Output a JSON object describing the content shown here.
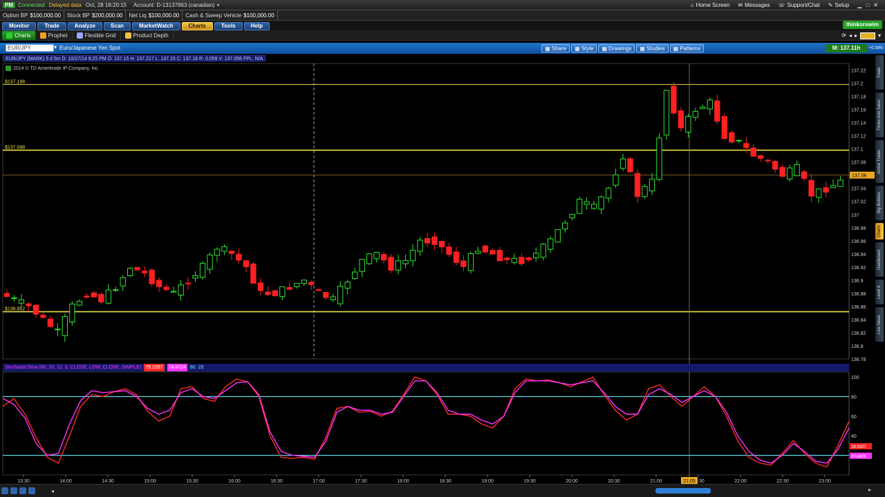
{
  "account_bar": {
    "pm": "PM",
    "connected": "Connected",
    "delayed": "Delayed data",
    "datetime": "Oct, 28  18:20:15",
    "account": "Account: D-13137963 (canadian)",
    "links": [
      {
        "label": "Home Screen",
        "icon": "home-icon"
      },
      {
        "label": "Messages",
        "icon": "envelope-icon"
      },
      {
        "label": "Support/Chat",
        "icon": "headset-icon"
      },
      {
        "label": "Setup",
        "icon": "wrench-icon"
      }
    ]
  },
  "balances": [
    {
      "label": "Option BP",
      "value": "$100,000.00"
    },
    {
      "label": "Stock BP",
      "value": "$200,000.00"
    },
    {
      "label": "Net Liq",
      "value": "$100,000.00"
    },
    {
      "label": "Cash & Sweep Vehicle",
      "value": "$100,000.00"
    }
  ],
  "main_tabs": [
    "Monitor",
    "Trade",
    "Analyze",
    "Scan",
    "MarketWatch",
    "Charts",
    "Tools",
    "Help"
  ],
  "main_tab_active": "Charts",
  "sub_tabs": [
    "Charts",
    "Prophet",
    "Flexible Grid",
    "Product Depth"
  ],
  "sub_tab_active": "Charts",
  "thinkorswim_label": "thinkorswim",
  "chart_toolbar": {
    "symbol": "EUR/JPY",
    "description": "Euro/Japanese Yen Spot",
    "buttons": [
      "Share",
      "Style",
      "Drawings",
      "Studies",
      "Patterns"
    ],
    "price_badge": "M: 137.11h",
    "change_badge": "+0.38%"
  },
  "ohlc_header": "EUR/JPY (MARK) 5 d 5m  D: 10/27/14 9:25 PM  O: 137.15  H: 137.217  L: 137.15  C: 137.16  R: 0.059  V: 137.056  FPL: N/A",
  "copyright": "2014 © TD Ameritrade IP Company, Inc.",
  "price_lines": [
    {
      "label": "$137.198",
      "value": 137.198,
      "color": "#f0e04a"
    },
    {
      "label": "$137.098",
      "value": 137.098,
      "color": "#f0e04a"
    },
    {
      "label": "$136.852",
      "value": 136.852,
      "color": "#f0e04a"
    }
  ],
  "last_price_tag": "137.06",
  "stoch_header": {
    "name": "StochasticSlow (80, 20, 12, 3, CLOSE, LOW, CLOSE, SIMPLE)",
    "k": "79.2267",
    "d": "74.8724",
    "ob": "80",
    "os": "20"
  },
  "stoch_tags": {
    "k": "28.9107",
    "d": "20.6506"
  },
  "x_tick_labels": [
    "13:30",
    "14:00",
    "14:30",
    "15:00",
    "15:30",
    "16:00",
    "16:30",
    "17:00",
    "17:30",
    "18:00",
    "18:30",
    "19:00",
    "19:30",
    "20:00",
    "20:30",
    "21:00",
    "21:30",
    "22:00",
    "22:30",
    "23:00"
  ],
  "crosshair_time": "21:05",
  "side_tabs": [
    "Trade",
    "Times And Sales",
    "Active Trader",
    "Big Buttons",
    "Charts",
    "Dashboard",
    "Level II",
    "Live News"
  ],
  "side_tab_active": "Charts",
  "chart_data": [
    {
      "type": "candlestick",
      "title": "EUR/JPY (MARK) 5 d 5m",
      "ylim": [
        136.78,
        137.23
      ],
      "yticks": [
        137.22,
        137.2,
        137.18,
        137.16,
        137.14,
        137.12,
        137.1,
        137.08,
        137.06,
        137.04,
        137.02,
        137,
        136.98,
        136.96,
        136.94,
        136.92,
        136.9,
        136.88,
        136.86,
        136.84,
        136.82,
        136.8,
        136.78
      ],
      "ytick_labels": [
        "137.22",
        "137.2",
        "137.18",
        "137.16",
        "137.14",
        "137.12",
        "137.1",
        "137.08",
        "137.06",
        "137.04",
        "137.02",
        "137",
        "136.98",
        "136.96",
        "136.94",
        "136.92",
        "136.9",
        "136.88",
        "136.86",
        "136.84",
        "136.82",
        "136.8",
        "136.78"
      ],
      "x_range": [
        "13:25",
        "23:15"
      ],
      "close_path": [
        136.87,
        136.86,
        136.84,
        136.82,
        136.86,
        136.88,
        136.87,
        136.89,
        136.92,
        136.91,
        136.89,
        136.88,
        136.9,
        136.92,
        136.95,
        136.94,
        136.92,
        136.88,
        136.88,
        136.89,
        136.9,
        136.88,
        136.87,
        136.9,
        136.93,
        136.94,
        136.92,
        136.93,
        136.96,
        136.96,
        136.94,
        136.92,
        136.95,
        136.94,
        136.93,
        136.93,
        136.94,
        136.96,
        136.99,
        137.02,
        137.01,
        137.04,
        137.09,
        137.03,
        137.05,
        137.19,
        137.13,
        137.16,
        137.17,
        137.12,
        137.11,
        137.09,
        137.08,
        137.06,
        137.07,
        137.03,
        137.04,
        137.05
      ]
    },
    {
      "type": "line",
      "title": "StochasticSlow (80, 20, 12, 3, CLOSE, LOW, CLOSE, SIMPLE)",
      "ylim": [
        0,
        105
      ],
      "yticks": [
        100,
        80,
        60,
        40
      ],
      "ytick_labels": [
        "100",
        "80",
        "60",
        "40"
      ],
      "levels": [
        80,
        20
      ],
      "series": [
        {
          "name": "k",
          "color": "#ff2a2a",
          "values": [
            70,
            78,
            62,
            38,
            18,
            12,
            40,
            70,
            82,
            80,
            85,
            88,
            82,
            65,
            55,
            60,
            88,
            90,
            78,
            75,
            90,
            98,
            95,
            80,
            40,
            18,
            17,
            18,
            16,
            38,
            68,
            70,
            64,
            65,
            60,
            65,
            82,
            100,
            96,
            82,
            62,
            62,
            60,
            52,
            48,
            60,
            88,
            98,
            96,
            97,
            94,
            90,
            95,
            100,
            82,
            66,
            56,
            62,
            88,
            92,
            80,
            70,
            80,
            90,
            80,
            60,
            35,
            18,
            12,
            10,
            22,
            35,
            22,
            12,
            8,
            30,
            55
          ]
        },
        {
          "name": "d",
          "color": "#ff33ff",
          "values": [
            78,
            72,
            58,
            32,
            20,
            22,
            52,
            76,
            86,
            84,
            85,
            86,
            80,
            68,
            62,
            66,
            84,
            88,
            80,
            78,
            86,
            94,
            95,
            82,
            44,
            24,
            20,
            19,
            18,
            34,
            64,
            70,
            66,
            66,
            62,
            64,
            80,
            96,
            96,
            84,
            66,
            62,
            62,
            56,
            52,
            60,
            84,
            96,
            96,
            96,
            94,
            92,
            94,
            96,
            84,
            70,
            62,
            62,
            82,
            88,
            82,
            74,
            80,
            86,
            80,
            64,
            40,
            24,
            15,
            12,
            20,
            32,
            24,
            14,
            12,
            26,
            48
          ]
        }
      ]
    }
  ]
}
